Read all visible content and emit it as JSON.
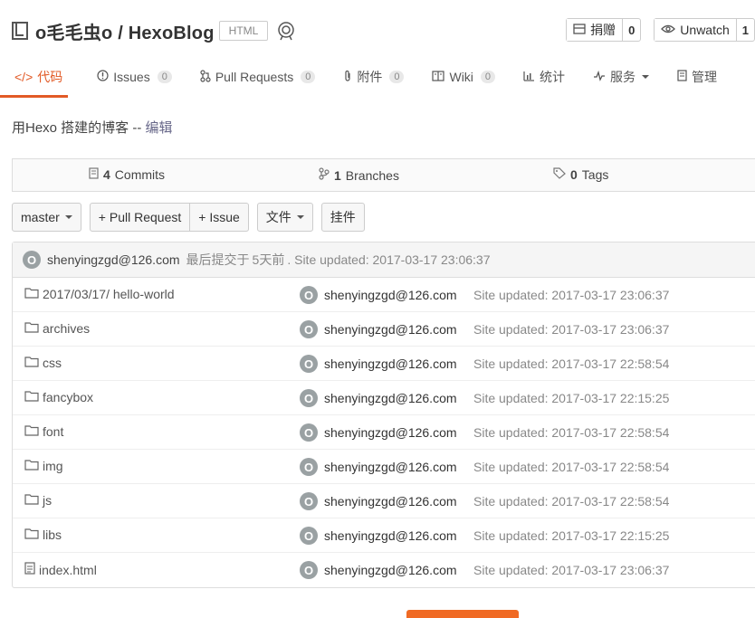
{
  "repo": {
    "title": "o毛毛虫o / HexoBlog",
    "language": "HTML",
    "icon": "repo-icon",
    "badge_icon": "badge-icon",
    "donate_label": "捐赠",
    "donate_count": "0",
    "watch_label": "Unwatch",
    "watch_count": "1"
  },
  "nav": {
    "code": "代码",
    "issues": "Issues",
    "issues_count": "0",
    "pull_requests": "Pull Requests",
    "pull_requests_count": "0",
    "attachments": "附件",
    "attachments_count": "0",
    "wiki": "Wiki",
    "wiki_count": "0",
    "stats": "统计",
    "services": "服务",
    "manage": "管理"
  },
  "description": {
    "text": "用Hexo 搭建的博客",
    "separator": "--",
    "edit": "编辑"
  },
  "stats": {
    "commits_count": "4",
    "commits_label": "Commits",
    "branches_count": "1",
    "branches_label": "Branches",
    "tags_count": "0",
    "tags_label": "Tags"
  },
  "toolbar": {
    "branch": "master",
    "pull_request": "+ Pull Request",
    "issue": "+ Issue",
    "file": "文件",
    "widget": "挂件"
  },
  "latest_commit": {
    "avatar": "O",
    "author": "shenyingzgd@126.com",
    "prefix": "最后提交于",
    "time": "5天前",
    "message": ". Site updated: 2017-03-17 23:06:37"
  },
  "files": [
    {
      "name": "2017/03/17/ hello-world",
      "type": "folder",
      "author": "shenyingzgd@126.com",
      "message": "Site updated: 2017-03-17 23:06:37"
    },
    {
      "name": "archives",
      "type": "folder",
      "author": "shenyingzgd@126.com",
      "message": "Site updated: 2017-03-17 23:06:37"
    },
    {
      "name": "css",
      "type": "folder",
      "author": "shenyingzgd@126.com",
      "message": "Site updated: 2017-03-17 22:58:54"
    },
    {
      "name": "fancybox",
      "type": "folder",
      "author": "shenyingzgd@126.com",
      "message": "Site updated: 2017-03-17 22:15:25"
    },
    {
      "name": "font",
      "type": "folder",
      "author": "shenyingzgd@126.com",
      "message": "Site updated: 2017-03-17 22:58:54"
    },
    {
      "name": "img",
      "type": "folder",
      "author": "shenyingzgd@126.com",
      "message": "Site updated: 2017-03-17 22:58:54"
    },
    {
      "name": "js",
      "type": "folder",
      "author": "shenyingzgd@126.com",
      "message": "Site updated: 2017-03-17 22:58:54"
    },
    {
      "name": "libs",
      "type": "folder",
      "author": "shenyingzgd@126.com",
      "message": "Site updated: 2017-03-17 22:15:25"
    },
    {
      "name": "index.html",
      "type": "file",
      "author": "shenyingzgd@126.com",
      "message": "Site updated: 2017-03-17 23:06:37"
    }
  ],
  "avatar_letter": "O",
  "colors": {
    "accent": "#e25a26",
    "avatar_bg": "#9aa1a3",
    "button_orange": "#f06a24"
  }
}
